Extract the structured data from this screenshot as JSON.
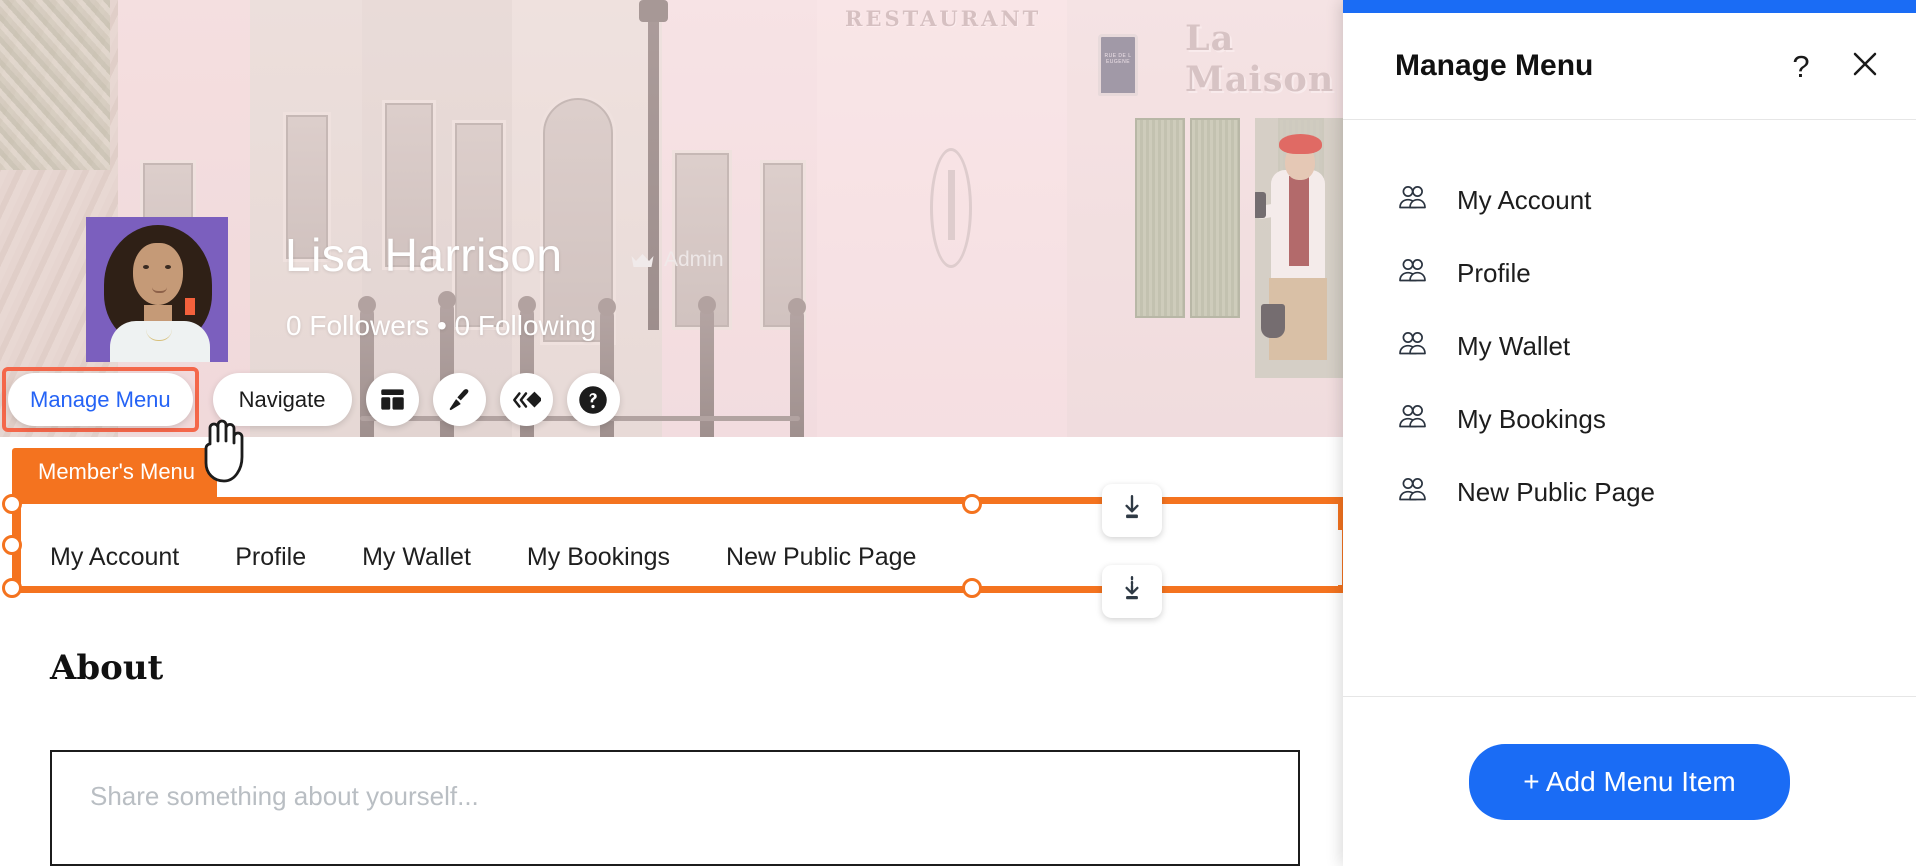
{
  "profile": {
    "name": "Lisa Harrison",
    "role_badge": "Admin",
    "role_icon": "crown-icon",
    "stats": "0 Followers • 0 Following",
    "avatar_alt": "Lisa Harrison avatar",
    "cover_signs": {
      "restaurant": "RESTAURANT",
      "maison": "La Maison",
      "plaque": "RUE DE L EUGENE"
    }
  },
  "toolbar": {
    "manage_menu_label": "Manage Menu",
    "navigate_label": "Navigate",
    "icon_buttons": [
      {
        "name": "layout-icon",
        "title": "Layout"
      },
      {
        "name": "brush-icon",
        "title": "Design"
      },
      {
        "name": "animation-icon",
        "title": "Animation"
      },
      {
        "name": "help-icon",
        "title": "Help"
      }
    ],
    "selected": "Manage Menu",
    "accent_selection_color": "#f4674a",
    "manage_menu_text_color": "#2563f5"
  },
  "selection": {
    "tag_label": "Member's Menu",
    "frame_color": "#f4731f",
    "dock_top_icon": "align-bottom-icon",
    "dock_bottom_icon": "align-bottom-dotted-icon"
  },
  "nav_tabs": [
    {
      "label": "My Account"
    },
    {
      "label": "Profile"
    },
    {
      "label": "My Wallet"
    },
    {
      "label": "My Bookings"
    },
    {
      "label": "New Public Page"
    }
  ],
  "about": {
    "heading": "About",
    "placeholder": "Share something about yourself...",
    "value": ""
  },
  "panel": {
    "accent_color": "#1a6cf5",
    "title": "Manage Menu",
    "help_label": "?",
    "close_label": "✕",
    "items": [
      {
        "label": "My Account",
        "icon": "members-group-icon"
      },
      {
        "label": "Profile",
        "icon": "members-group-icon"
      },
      {
        "label": "My Wallet",
        "icon": "members-group-icon"
      },
      {
        "label": "My Bookings",
        "icon": "members-group-icon"
      },
      {
        "label": "New Public Page",
        "icon": "members-group-icon"
      }
    ],
    "add_button_label": "+ Add Menu Item"
  }
}
